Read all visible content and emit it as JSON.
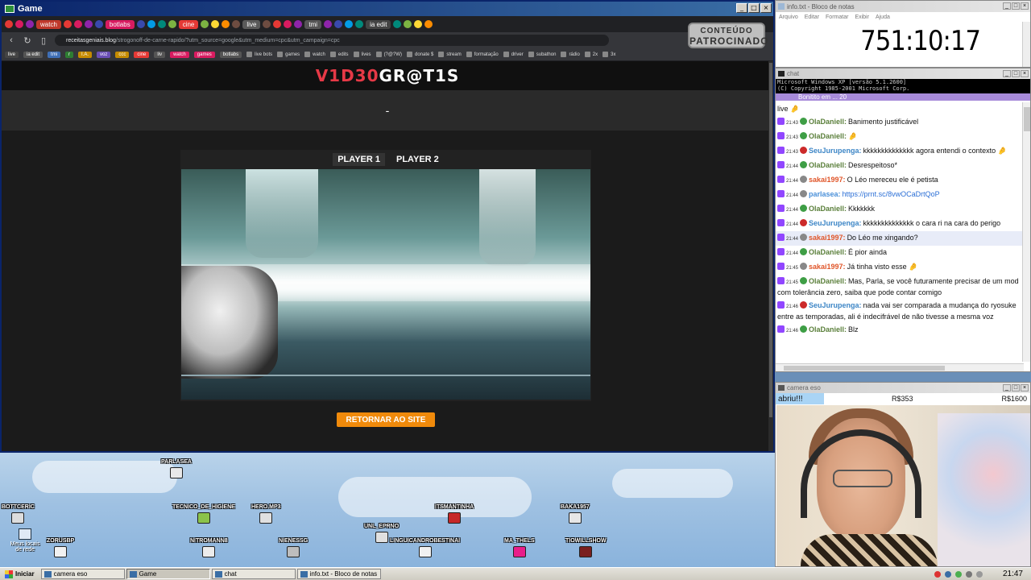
{
  "game_window": {
    "title": "Game",
    "tabs": [
      {
        "label": "watch",
        "color": "#c0392b"
      },
      {
        "label": "botlabs",
        "color": "#d81b60"
      },
      {
        "label": "cine",
        "color": "#e53935"
      },
      {
        "label": "live",
        "color": "#5a5a5a"
      },
      {
        "label": "tmi",
        "color": "#555555"
      },
      {
        "label": "ia edit",
        "color": "#444444"
      }
    ],
    "url_host": "receitasgeniais.blog",
    "url_path": "/strogonoff-de-carne-rapido/?utm_source=google&utm_medium=cpc&utm_campaign=cpc",
    "sponsor_badge": [
      "CONTEÚDO",
      "PATROCINADO"
    ],
    "bookmark_chips": [
      {
        "label": "live",
        "color": "#444"
      },
      {
        "label": "ia edit",
        "color": "#555"
      },
      {
        "label": "tmi",
        "color": "#3f6fb5"
      },
      {
        "label": "r",
        "color": "#2e7d32"
      },
      {
        "label": "I.A.",
        "color": "#c58b00"
      },
      {
        "label": "voz",
        "color": "#6a4fb5"
      },
      {
        "label": "ccc",
        "color": "#c58b00"
      },
      {
        "label": "cine",
        "color": "#e53935"
      },
      {
        "label": "liv",
        "color": "#555"
      },
      {
        "label": "watch",
        "color": "#d81b60"
      },
      {
        "label": "games",
        "color": "#d81b60"
      },
      {
        "label": "botlabs",
        "color": "#555"
      }
    ],
    "bookmarks": [
      "live bots",
      "games",
      "watch",
      "edits",
      "lives",
      "(?@?W)",
      "donate $",
      "stream",
      "formatação",
      "driver",
      "subathon",
      "rádio",
      "2x",
      "3x"
    ],
    "logo_red": "V1D30",
    "logo_white": "GR@T1S",
    "subbar_text": "-",
    "player_tabs": [
      "PLAYER 1",
      "PLAYER 2"
    ],
    "return_button": "RETORNAR AO SITE"
  },
  "desktop": {
    "icon_label": "Meus locais de rede",
    "avatars": [
      {
        "name": "PARLASEA",
        "color": "#e9e9e9"
      },
      {
        "name": "BOTTCERIC",
        "color": "#dddddd"
      },
      {
        "name": "TECNICO_DE_HIGIENE",
        "color": "#8bc34a"
      },
      {
        "name": "HERO.MP3",
        "color": "#e0e0e0"
      },
      {
        "name": "ITSMANTINHA",
        "color": "#c62828"
      },
      {
        "name": "BAKA1957",
        "color": "#e6e6e6"
      },
      {
        "name": "ZORUSBP",
        "color": "#f1f1f1"
      },
      {
        "name": "NITROMANN8",
        "color": "#ececec"
      },
      {
        "name": "NIENESSG",
        "color": "#bdbdbd"
      },
      {
        "name": "UNL_EPRNO",
        "color": "#e0e0e0"
      },
      {
        "name": "LINGUICANDROBESTINAI",
        "color": "#f1f1f1"
      },
      {
        "name": "MA_THELS",
        "color": "#e91e8a"
      },
      {
        "name": "TIOWILLSHOW",
        "color": "#7a1f1f"
      }
    ]
  },
  "taskbar": {
    "start": "Iniciar",
    "tasks": [
      "camera eso",
      "Game",
      "chat",
      "info.txt - Bloco de notas"
    ],
    "active_task": "Game",
    "clock": "21:47"
  },
  "notepad": {
    "title": "info.txt - Bloco de notas",
    "menu": [
      "Arquivo",
      "Editar",
      "Formatar",
      "Exibir",
      "Ajuda"
    ],
    "timer": "751:10:17"
  },
  "chat": {
    "title": "chat",
    "cmd_lines": [
      "Microsoft Windows XP [versão 5.1.2600]",
      "(C) Copyright 1985-2001 Microsoft Corp."
    ],
    "purple_text": "Bonitito em ... 20",
    "messages": [
      {
        "ts": "",
        "user": "",
        "user_color": "#111",
        "badge": "",
        "text": "live 🤌"
      },
      {
        "ts": "21:43",
        "user": "OlaDaniell:",
        "user_color": "#5a7f3a",
        "badge": "#3e9e45",
        "text": "Banimento justificável"
      },
      {
        "ts": "21:43",
        "user": "OlaDaniell:",
        "user_color": "#5a7f3a",
        "badge": "#3e9e45",
        "text": "🤌"
      },
      {
        "ts": "21:43",
        "user": "SeuJurupenga:",
        "user_color": "#3d86c6",
        "badge": "#cc2a2a",
        "text": "kkkkkkkkkkkkkk agora entendi o contexto 🤌"
      },
      {
        "ts": "21:44",
        "user": "OlaDaniell:",
        "user_color": "#5a7f3a",
        "badge": "#3e9e45",
        "text": "Desrespeitoso*"
      },
      {
        "ts": "21:44",
        "user": "sakai1997:",
        "user_color": "#e0562a",
        "badge": "#888",
        "text": "O Léo mereceu ele é petista"
      },
      {
        "ts": "21:44",
        "user": "parlasea:",
        "user_color": "#4a90d9",
        "badge": "#888",
        "text": "https://prnt.sc/8vwOCaDrtQoP",
        "link": true
      },
      {
        "ts": "21:44",
        "user": "OlaDaniell:",
        "user_color": "#5a7f3a",
        "badge": "#3e9e45",
        "text": "Kkkkkkk"
      },
      {
        "ts": "21:44",
        "user": "SeuJurupenga:",
        "user_color": "#3d86c6",
        "badge": "#cc2a2a",
        "text": "kkkkkkkkkkkkkk o cara ri na cara do perigo"
      },
      {
        "ts": "21:44",
        "user": "sakai1997:",
        "user_color": "#e0562a",
        "badge": "#888",
        "text": "Do Léo me xingando?",
        "highlight": true
      },
      {
        "ts": "21:44",
        "user": "OlaDaniell:",
        "user_color": "#5a7f3a",
        "badge": "#3e9e45",
        "text": "É pior ainda"
      },
      {
        "ts": "21:45",
        "user": "sakai1997:",
        "user_color": "#e0562a",
        "badge": "#888",
        "text": "Já tinha visto esse 🤌"
      },
      {
        "ts": "21:45",
        "user": "OlaDaniell:",
        "user_color": "#5a7f3a",
        "badge": "#3e9e45",
        "text": "Mas, Parla, se você futuramente precisar de um mod com tolerância zero, saiba que pode contar comigo"
      },
      {
        "ts": "21:46",
        "user": "SeuJurupenga:",
        "user_color": "#3d86c6",
        "badge": "#cc2a2a",
        "text": "nada vai ser comparada a mudança do ryosuke entre as temporadas, ali é indecifrável de não tivesse a mesma voz"
      },
      {
        "ts": "21:46",
        "user": "OlaDaniell:",
        "user_color": "#5a7f3a",
        "badge": "#3e9e45",
        "text": "Blz"
      }
    ]
  },
  "camera": {
    "title": "camera eso",
    "goal_label": "abriu!!!",
    "goal_mid": "R$353",
    "goal_end": "R$1600",
    "goal_fraction": 0.19
  }
}
